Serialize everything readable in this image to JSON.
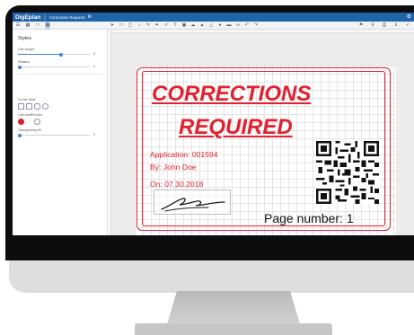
{
  "app": {
    "title": "DigEplan",
    "document_tab": "Corrections Required"
  },
  "sidebar": {
    "heading": "Styles",
    "line_weight_label": "Line weight",
    "line_weight_value": "8",
    "rotation_label": "Rotation",
    "rotation_value": "0",
    "corner_style_label": "Corner Style",
    "line_color_label": "Line color",
    "fill_color_label": "Fill color",
    "transparency_label": "Transparency fill",
    "transparency_value": "0",
    "line_color": "#d6202e",
    "accent_color": "#3a86d6"
  },
  "stamp": {
    "title_line1": "CORRECTIONS",
    "title_line2": "REQUIRED",
    "application": "Application:  001594",
    "by": "By:  John Doe",
    "on": "On:  07.30.2018",
    "page_number": "Page number:  1",
    "color": "#e12030"
  }
}
